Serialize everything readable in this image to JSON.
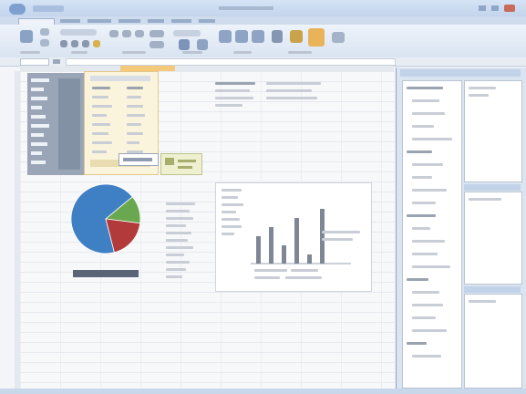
{
  "app": {
    "title": "",
    "tabs": [
      "",
      "",
      "",
      "",
      "",
      "",
      ""
    ]
  },
  "ribbon": {
    "groups": [
      "",
      "",
      "",
      "",
      ""
    ],
    "accent": "#e9b35a"
  },
  "workbook": {
    "text_block_label": "",
    "pie_caption": "",
    "column_chart_title": "",
    "legend_text": ""
  },
  "chart_data": [
    {
      "type": "pie",
      "title": "",
      "slices": [
        {
          "name": "",
          "value": 68,
          "color": "#3f7fc4"
        },
        {
          "name": "",
          "value": 13,
          "color": "#6aa84f"
        },
        {
          "name": "",
          "value": 19,
          "color": "#b23a3a"
        }
      ]
    },
    {
      "type": "bar",
      "title": "",
      "categories": [
        "",
        "",
        "",
        "",
        "",
        ""
      ],
      "values": [
        3,
        4,
        2,
        5,
        1,
        6
      ],
      "ylim": [
        0,
        7
      ]
    }
  ],
  "field_list": {
    "title": "",
    "items": [
      "",
      "",
      "",
      "",
      "",
      "",
      "",
      "",
      "",
      "",
      "",
      "",
      "",
      "",
      "",
      "",
      "",
      "",
      "",
      "",
      "",
      ""
    ]
  },
  "colors": {
    "ribbon_bg": "#dfe8f4",
    "titlebar_bg": "#c7d8ee",
    "sheet_bg": "#f7f8fa",
    "selection": "#fff7d6"
  }
}
